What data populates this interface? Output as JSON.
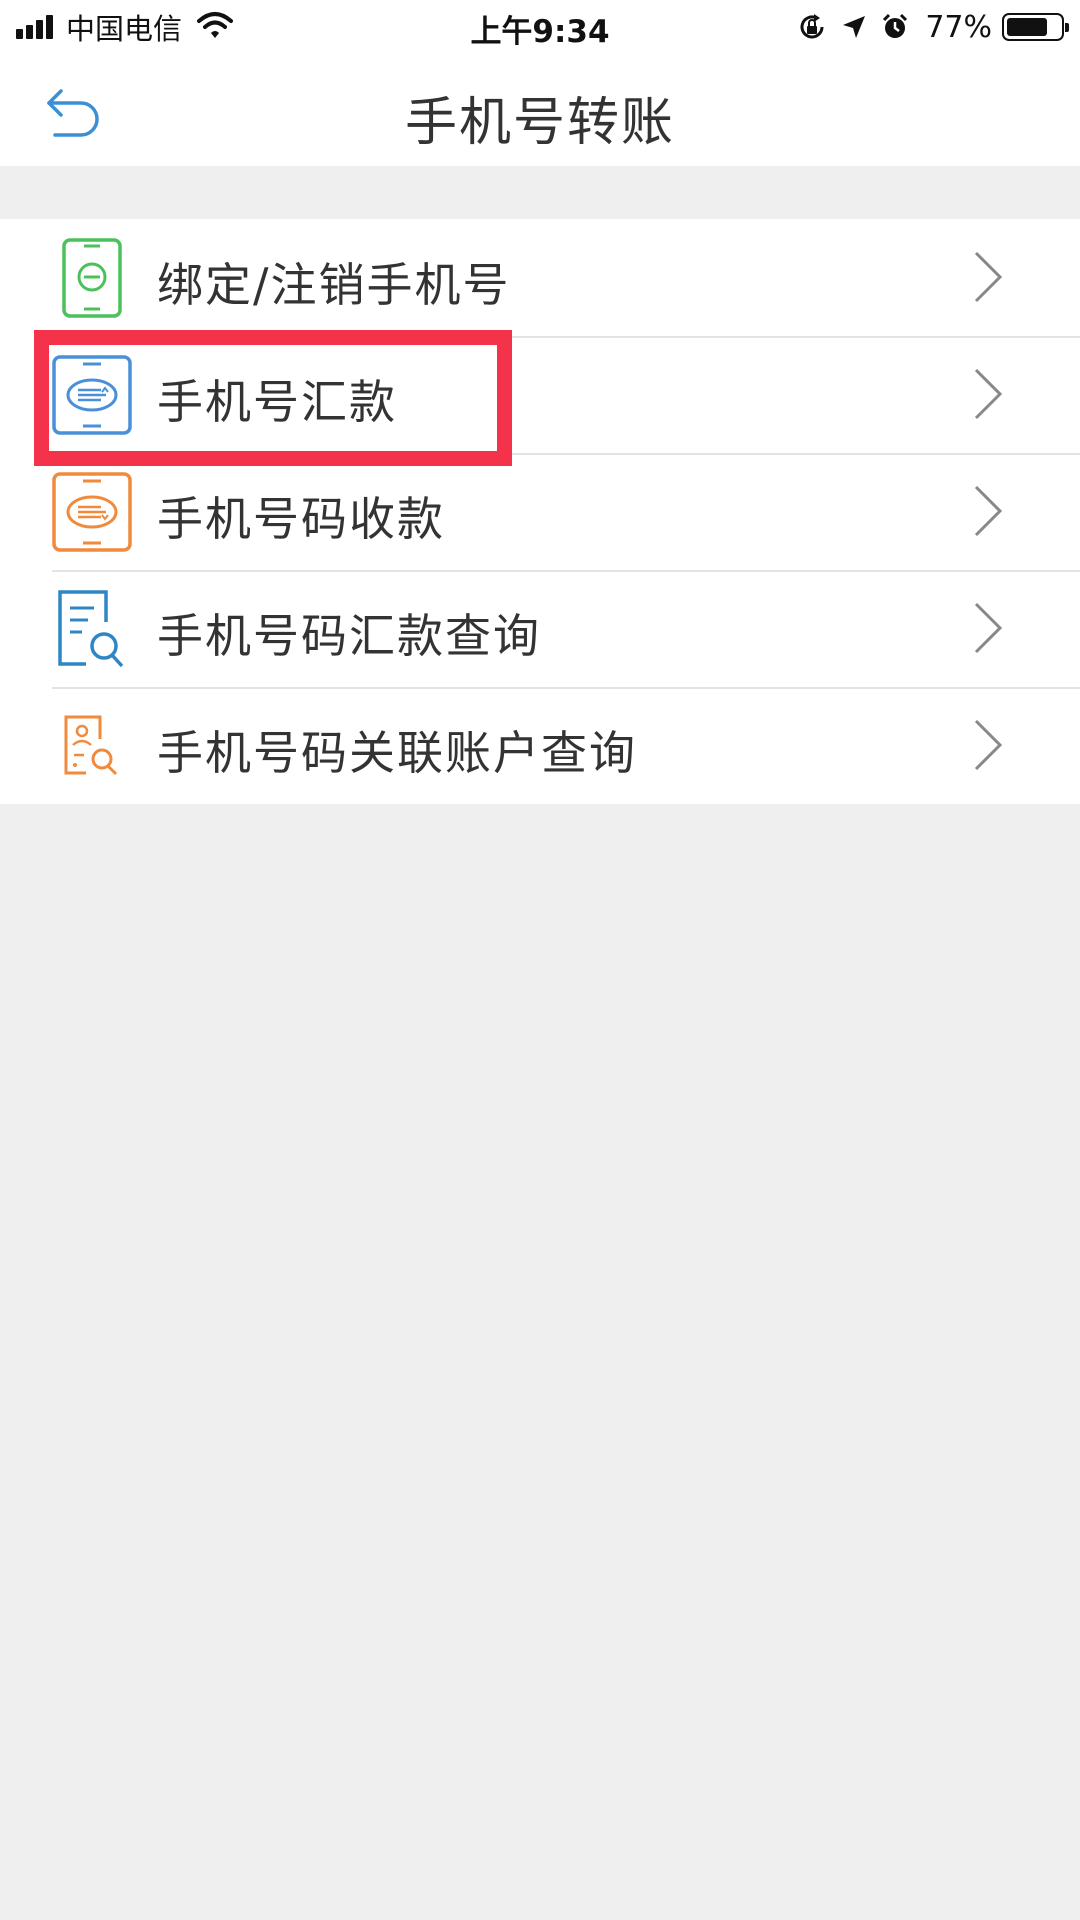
{
  "status_bar": {
    "carrier": "中国电信",
    "time": "上午9:34",
    "battery_percent": "77%",
    "battery_level": 0.77,
    "icons": [
      "signal-icon",
      "wifi-icon",
      "rotation-lock-icon",
      "location-arrow-icon",
      "alarm-icon",
      "battery-icon"
    ]
  },
  "header": {
    "title": "手机号转账",
    "back_icon": "back-arrow-icon"
  },
  "menu": {
    "items": [
      {
        "label": "绑定/注销手机号",
        "icon": "phone-bind-icon",
        "color": "#4cc05a"
      },
      {
        "label": "手机号汇款",
        "icon": "phone-remit-icon",
        "color": "#4a90d9"
      },
      {
        "label": "手机号码收款",
        "icon": "phone-receive-icon",
        "color": "#f08a3c"
      },
      {
        "label": "手机号码汇款查询",
        "icon": "remit-query-icon",
        "color": "#2f86c4"
      },
      {
        "label": "手机号码关联账户查询",
        "icon": "account-query-icon",
        "color": "#f08a3c"
      }
    ]
  },
  "colors": {
    "highlight": "#f4324a",
    "background": "#efefef",
    "back_arrow": "#3a8fd6"
  }
}
